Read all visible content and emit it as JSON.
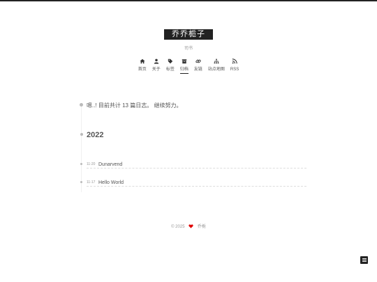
{
  "site": {
    "title": "乔乔栀子",
    "subtitle": "司书"
  },
  "nav": [
    {
      "label": "首页",
      "icon": "home-icon"
    },
    {
      "label": "关于",
      "icon": "user-icon"
    },
    {
      "label": "标签",
      "icon": "tags-icon"
    },
    {
      "label": "归档",
      "icon": "archive-icon",
      "active": true
    },
    {
      "label": "友链",
      "icon": "link-icon"
    },
    {
      "label": "站点地图",
      "icon": "sitemap-icon"
    },
    {
      "label": "RSS",
      "icon": "rss-icon"
    }
  ],
  "archive": {
    "summary": "嗯..! 目前共计 13 篇日志。 继续努力。",
    "year": "2022",
    "posts": [
      {
        "date": "11-20",
        "title": "Dunarvend"
      },
      {
        "date": "11-17",
        "title": "Hello World"
      }
    ]
  },
  "footer": {
    "copyright": "© 2025",
    "author": "乔栀",
    "heart_color": "#e00000"
  },
  "colors": {
    "brand_bg": "#222222",
    "timeline_dot": "#bbbbbb"
  }
}
